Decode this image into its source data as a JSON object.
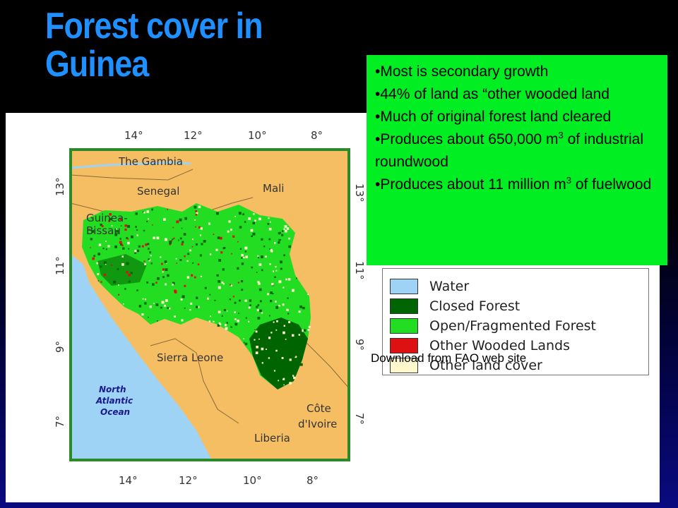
{
  "slide": {
    "title_line1": "Forest cover in",
    "title_line2": "Guinea"
  },
  "map": {
    "lon_ticks": [
      "14°",
      "12°",
      "10°",
      "8°"
    ],
    "lat_ticks": [
      "13°",
      "11°",
      "9°",
      "7°"
    ],
    "place_labels": {
      "gambia": "The Gambia",
      "senegal": "Senegal",
      "mali": "Mali",
      "guinea_bissau_1": "Guinea-",
      "guinea_bissau_2": "Bissau",
      "sierra_leone": "Sierra Leone",
      "liberia": "Liberia",
      "cote_1": "Côte",
      "cote_2": "d'Ivoire",
      "ocean_1": "North",
      "ocean_2": "Atlantic",
      "ocean_3": "Ocean"
    },
    "colors": {
      "water": "#9fd3f5",
      "closed_forest": "#006400",
      "open_forest": "#22dd22",
      "other_wooded": "#dd1111",
      "other_land": "#fff8cc",
      "neighbors": "#f5be62"
    }
  },
  "legend": {
    "items": [
      {
        "label": "Water",
        "color": "#9fd3f5"
      },
      {
        "label": "Closed Forest",
        "color": "#006400"
      },
      {
        "label": "Open/Fragmented Forest",
        "color": "#22dd22"
      },
      {
        "label": "Other Wooded Lands",
        "color": "#dd1111"
      },
      {
        "label": "Other land cover",
        "color": "#fff8cc"
      }
    ]
  },
  "info_box": {
    "bullet_1": "•Most is secondary growth",
    "bullet_2": "•44% of land as “other wooded land",
    "bullet_3": "•Much of original forest land cleared",
    "bullet_4_pre": "•Produces about 650,000 m",
    "bullet_4_sup": "3",
    "bullet_4_post": " of industrial roundwood",
    "bullet_5_pre": "•Produces about 11 million m",
    "bullet_5_sup": "3",
    "bullet_5_post": " of fuelwood"
  },
  "credit": "Download from FAO web site"
}
